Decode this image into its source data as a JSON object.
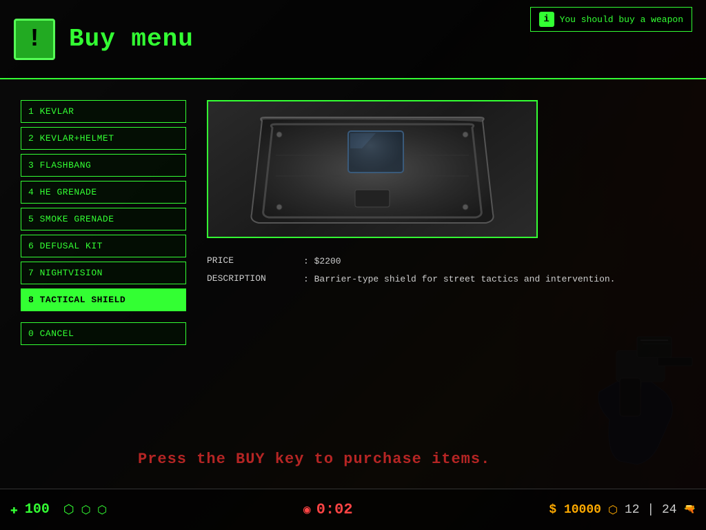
{
  "header": {
    "icon": "!",
    "title": "Buy menu"
  },
  "notification": {
    "icon": "i",
    "text": "You should buy a weapon"
  },
  "menu_items": [
    {
      "key": "1",
      "label": "1 KEVLAR",
      "active": false
    },
    {
      "key": "2",
      "label": "2 KEVLAR+HELMET",
      "active": false
    },
    {
      "key": "3",
      "label": "3 FLASHBANG",
      "active": false
    },
    {
      "key": "4",
      "label": "4 HE GRENADE",
      "active": false
    },
    {
      "key": "5",
      "label": "5 SMOKE GRENADE",
      "active": false
    },
    {
      "key": "6",
      "label": "6 DEFUSAL KIT",
      "active": false
    },
    {
      "key": "7",
      "label": "7 NIGHTVISION",
      "active": false
    },
    {
      "key": "8",
      "label": "8 TACTICAL SHIELD",
      "active": true
    },
    {
      "key": "0",
      "label": "0 CANCEL",
      "active": false
    }
  ],
  "item_detail": {
    "price_label": "PRICE",
    "price_separator": ": $2200",
    "description_label": "DESCRIPTION",
    "description_value": ": Barrier-type shield for street tactics and intervention."
  },
  "press_buy": {
    "message": "Press the BUY key to purchase items."
  },
  "hud": {
    "health_icon": "✚",
    "health": "100",
    "armor_icon": "⬡",
    "bomb_icon": "◉",
    "timer": "0:02",
    "money": "$ 10000",
    "ammo": "12 | 24",
    "ammo_icon": "⬡"
  }
}
